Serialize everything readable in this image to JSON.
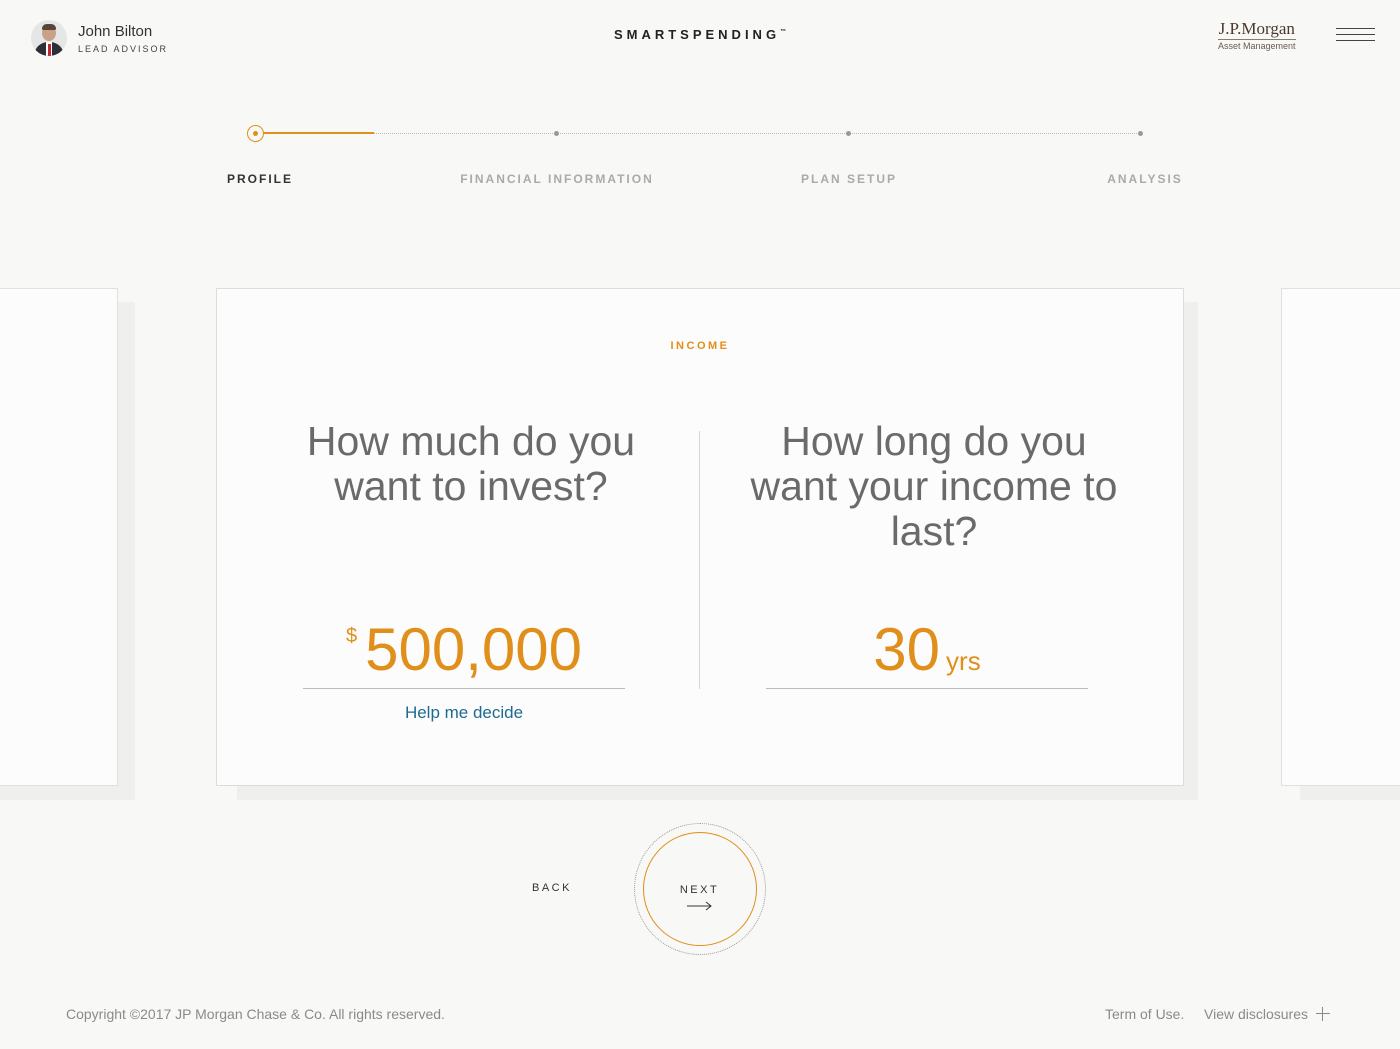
{
  "header": {
    "advisor_name": "John Bilton",
    "advisor_role": "LEAD ADVISOR",
    "app_title": "SMARTSPENDING",
    "trademark": "™",
    "logo_main": "J.P.Morgan",
    "logo_sub": "Asset Management"
  },
  "stepper": {
    "steps": [
      {
        "label": "PROFILE",
        "state": "active"
      },
      {
        "label": "FINANCIAL INFORMATION",
        "state": "upcoming"
      },
      {
        "label": "PLAN SETUP",
        "state": "upcoming"
      },
      {
        "label": "ANALYSIS",
        "state": "upcoming"
      }
    ],
    "accent_color": "#e08f1a"
  },
  "card": {
    "section_label": "INCOME",
    "left": {
      "question": "How much do you want to invest?",
      "currency": "$",
      "value": "500,000",
      "help_link": "Help me decide"
    },
    "right": {
      "question": "How long do you want your income to last?",
      "value": "30",
      "unit": "yrs"
    }
  },
  "nav": {
    "back_label": "BACK",
    "next_label": "NEXT"
  },
  "footer": {
    "copyright": "Copyright ©2017  JP Morgan Chase & Co. All rights reserved.",
    "terms": "Term of Use.",
    "disclosures": "View disclosures"
  },
  "icons": [
    "avatar",
    "menu-icon",
    "arrow-right-icon",
    "plus-icon"
  ],
  "colors": {
    "accent": "#e08f1a",
    "link": "#1d6a94",
    "background": "#f8f8f7"
  }
}
